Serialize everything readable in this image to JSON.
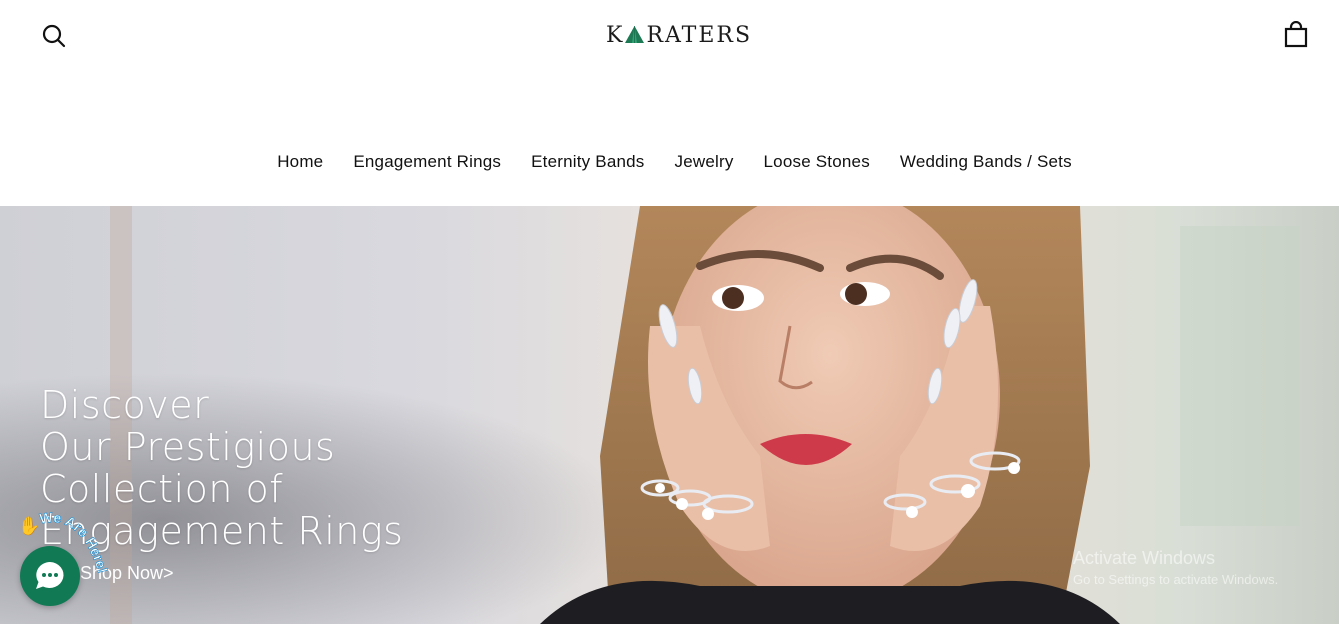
{
  "brand": {
    "logo_prefix": "K",
    "logo_suffix": "RATERS",
    "accent": "#1d7a55"
  },
  "header": {
    "search_icon": "search-icon",
    "cart_icon": "shopping-bag-icon"
  },
  "nav": {
    "items": [
      {
        "label": "Home"
      },
      {
        "label": "Engagement Rings"
      },
      {
        "label": "Eternity Bands"
      },
      {
        "label": "Jewelry"
      },
      {
        "label": "Loose Stones"
      },
      {
        "label": "Wedding Bands / Sets"
      }
    ]
  },
  "hero": {
    "heading_lines": [
      "Discover",
      "Our Prestigious",
      "Collection of",
      "Engagement Rings"
    ],
    "cta": "Shop Now>"
  },
  "chat": {
    "badge_text": "We Are Here!",
    "badge_emoji": "✋",
    "bubble_color": "#117a55"
  },
  "os_watermark": {
    "title": "Activate Windows",
    "subtitle": "Go to Settings to activate Windows."
  }
}
